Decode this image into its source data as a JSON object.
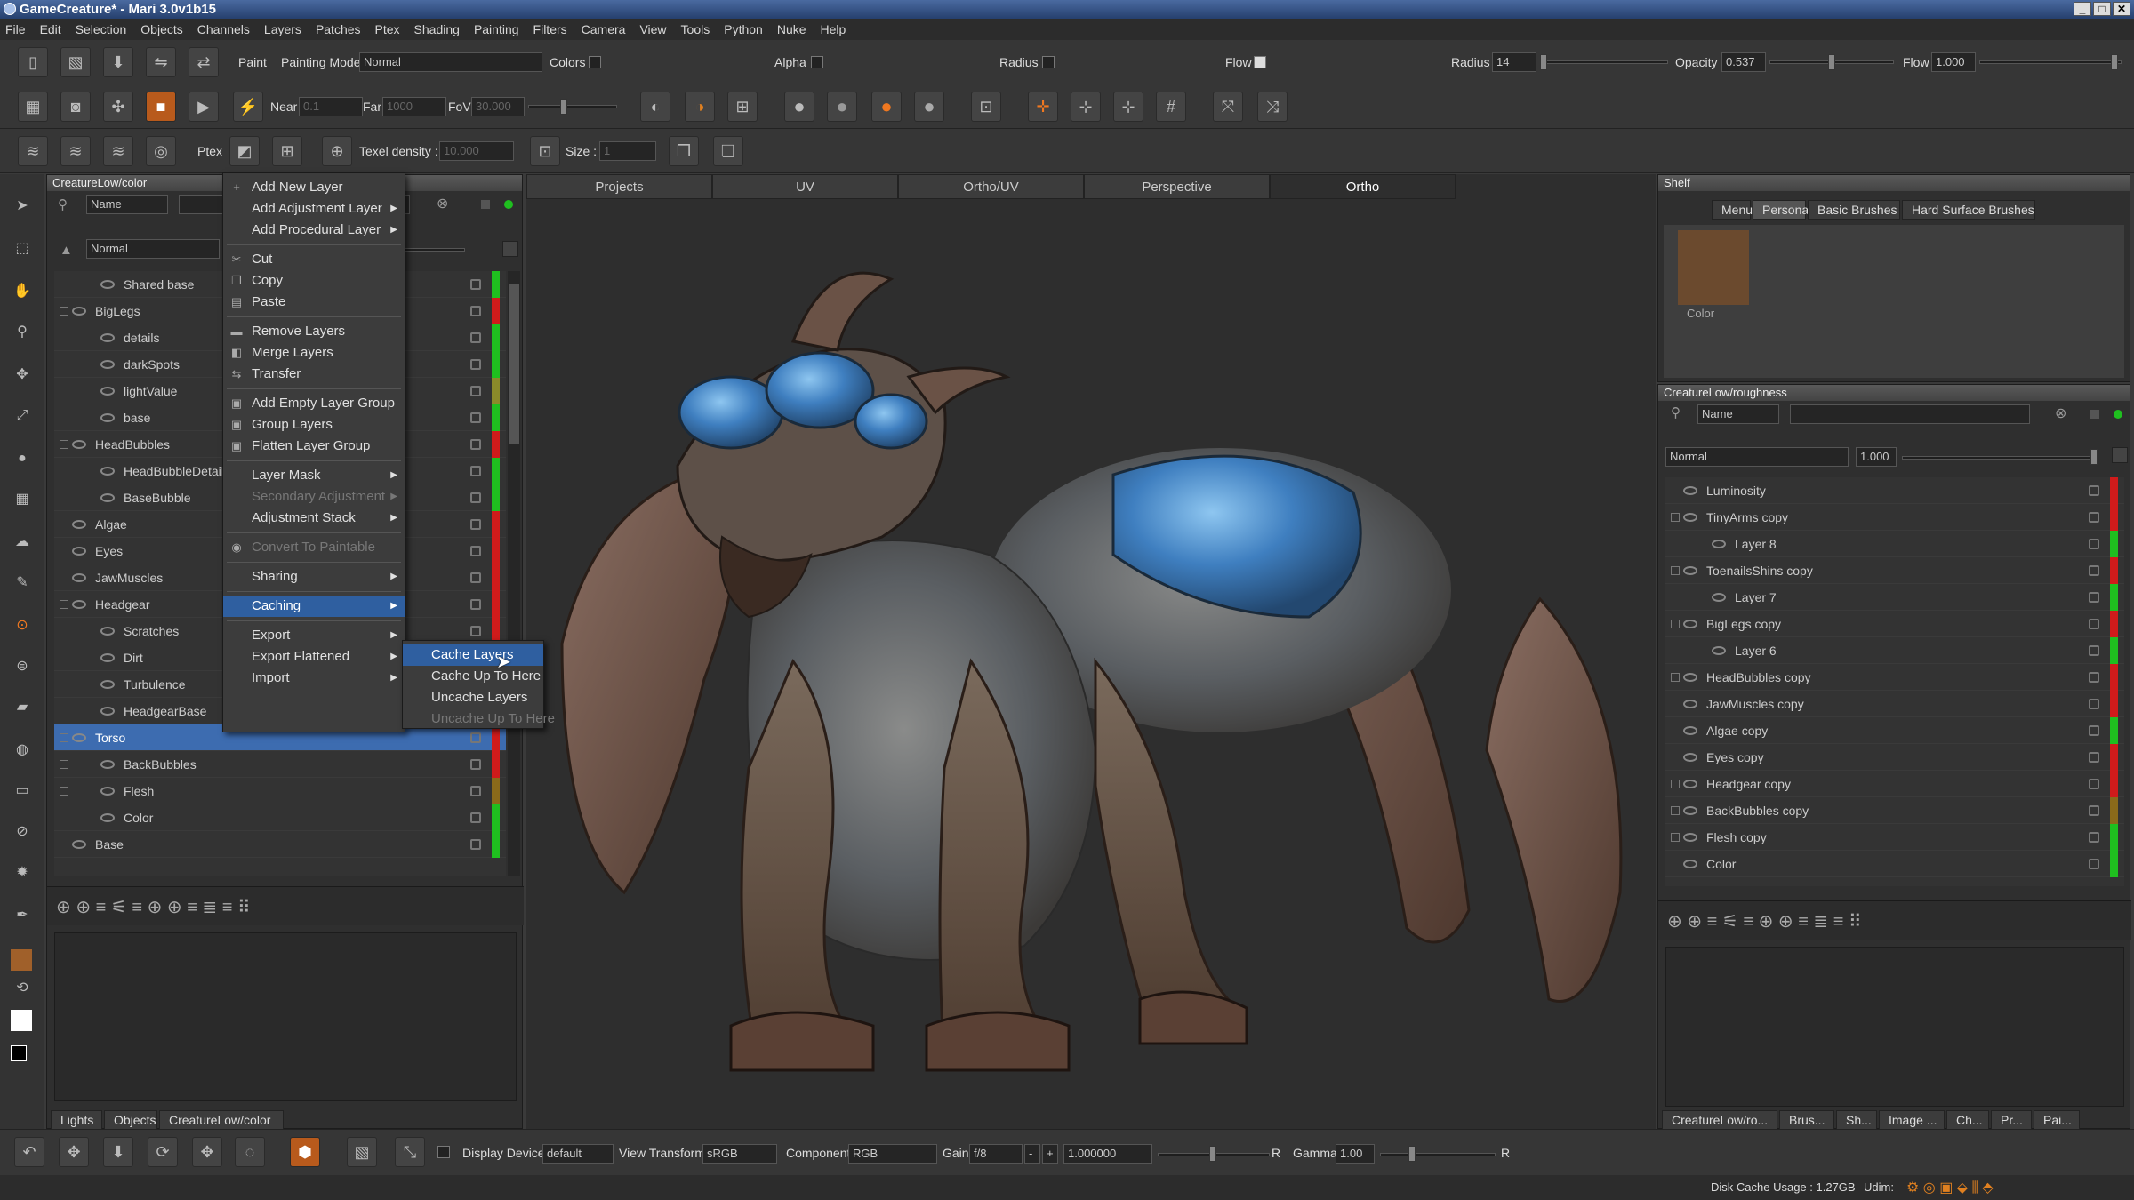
{
  "window": {
    "title": "GameCreature* - Mari 3.0v1b15"
  },
  "menubar": [
    "File",
    "Edit",
    "Selection",
    "Objects",
    "Channels",
    "Layers",
    "Patches",
    "Ptex",
    "Shading",
    "Painting",
    "Filters",
    "Camera",
    "View",
    "Tools",
    "Python",
    "Nuke",
    "Help"
  ],
  "toolbar1": {
    "paint_label": "Paint",
    "painting_mode_label": "Painting Mode",
    "painting_mode_value": "Normal",
    "colors_label": "Colors",
    "alpha_label": "Alpha",
    "radius_check_label": "Radius",
    "flow_check_label": "Flow",
    "radius_label": "Radius",
    "radius_value": "14",
    "opacity_label": "Opacity",
    "opacity_value": "0.537",
    "flow_label": "Flow",
    "flow_value": "1.000"
  },
  "toolbar2": {
    "near_label": "Near",
    "near_value": "0.1",
    "far_label": "Far",
    "far_value": "1000",
    "fov_label": "FoV",
    "fov_value": "30.000"
  },
  "toolbar3": {
    "ptex_label": "Ptex",
    "texel_label": "Texel density :",
    "texel_value": "10.000",
    "size_label": "Size :",
    "size_value": "1"
  },
  "left_panel": {
    "title": "CreatureLow/color",
    "filter_field": "Name",
    "blend_mode": "Normal",
    "layers": [
      {
        "name": "Shared base",
        "indent": 2,
        "bar": "#1fbf1f"
      },
      {
        "name": "BigLegs",
        "indent": 1,
        "group": true,
        "bar": "#d01b1b"
      },
      {
        "name": "details",
        "indent": 2,
        "bar": "#1fbf1f"
      },
      {
        "name": "darkSpots",
        "indent": 2,
        "bar": "#1fbf1f"
      },
      {
        "name": "lightValue",
        "indent": 2,
        "bar": "#8a8a2a"
      },
      {
        "name": "base",
        "indent": 2,
        "bar": "#1fbf1f"
      },
      {
        "name": "HeadBubbles",
        "indent": 1,
        "group": true,
        "bar": "#d01b1b"
      },
      {
        "name": "HeadBubbleDetail",
        "indent": 2,
        "bar": "#1fbf1f"
      },
      {
        "name": "BaseBubble",
        "indent": 2,
        "bar": "#1fbf1f"
      },
      {
        "name": "Algae",
        "indent": 1,
        "bar": "#d01b1b"
      },
      {
        "name": "Eyes",
        "indent": 1,
        "bar": "#d01b1b"
      },
      {
        "name": "JawMuscles",
        "indent": 1,
        "bar": "#d01b1b"
      },
      {
        "name": "Headgear",
        "indent": 1,
        "group": true,
        "bar": "#d01b1b"
      },
      {
        "name": "Scratches",
        "indent": 2,
        "bar": "#d01b1b"
      },
      {
        "name": "Dirt",
        "indent": 2,
        "bar": "#d01b1b"
      },
      {
        "name": "Turbulence",
        "indent": 2,
        "bar": "#d01b1b"
      },
      {
        "name": "HeadgearBase",
        "indent": 2,
        "bar": "#d01b1b"
      },
      {
        "name": "Torso",
        "indent": 1,
        "group": true,
        "selected": true,
        "bar": "#d01b1b"
      },
      {
        "name": "BackBubbles",
        "indent": 2,
        "group": true,
        "bar": "#d01b1b"
      },
      {
        "name": "Flesh",
        "indent": 2,
        "group": true,
        "bar": "#8a6a1a"
      },
      {
        "name": "Color",
        "indent": 2,
        "bar": "#1fbf1f"
      },
      {
        "name": "Base",
        "indent": 1,
        "bar": "#1fbf1f"
      }
    ],
    "tabs": [
      "Lights",
      "Objects",
      "CreatureLow/color"
    ]
  },
  "context_menu": {
    "items": [
      {
        "label": "Add New Layer",
        "icon": "+"
      },
      {
        "label": "Add Adjustment Layer",
        "sub": true
      },
      {
        "label": "Add Procedural Layer",
        "sub": true
      },
      {
        "sep": true
      },
      {
        "label": "Cut",
        "icon": "✂"
      },
      {
        "label": "Copy",
        "icon": "❐"
      },
      {
        "label": "Paste",
        "icon": "▤"
      },
      {
        "sep": true
      },
      {
        "label": "Remove Layers",
        "icon": "▬"
      },
      {
        "label": "Merge Layers",
        "icon": "◧"
      },
      {
        "label": "Transfer",
        "icon": "⇆"
      },
      {
        "sep": true
      },
      {
        "label": "Add Empty Layer Group",
        "icon": "▣"
      },
      {
        "label": "Group Layers",
        "icon": "▣"
      },
      {
        "label": "Flatten Layer Group",
        "icon": "▣"
      },
      {
        "sep": true
      },
      {
        "label": "Layer Mask",
        "sub": true
      },
      {
        "label": "Secondary Adjustment",
        "sub": true,
        "disabled": true
      },
      {
        "label": "Adjustment Stack",
        "sub": true
      },
      {
        "sep": true
      },
      {
        "label": "Convert To Paintable",
        "icon": "◉",
        "disabled": true
      },
      {
        "sep": true
      },
      {
        "label": "Sharing",
        "sub": true
      },
      {
        "sep": true
      },
      {
        "label": "Caching",
        "sub": true,
        "highlight": true
      },
      {
        "sep": true
      },
      {
        "label": "Export",
        "sub": true
      },
      {
        "label": "Export Flattened",
        "sub": true
      },
      {
        "label": "Import",
        "sub": true
      }
    ],
    "submenu": [
      {
        "label": "Cache Layers",
        "highlight": true
      },
      {
        "label": "Cache Up To Here"
      },
      {
        "label": "Uncache Layers"
      },
      {
        "label": "Uncache Up To Here",
        "disabled": true
      }
    ]
  },
  "viewport": {
    "tabs": [
      "Projects",
      "UV",
      "Ortho/UV",
      "Perspective",
      "Ortho"
    ],
    "active_tab": "Ortho"
  },
  "shelf": {
    "title": "Shelf",
    "tabs": [
      "Menu",
      "Personal",
      "Basic Brushes",
      "Hard Surface Brushes"
    ],
    "active_tab": "Personal",
    "swatch_label": "Color",
    "swatch_color": "#6b4a2e"
  },
  "right_panel": {
    "title": "CreatureLow/roughness",
    "filter_field": "Name",
    "blend_mode": "Normal",
    "opacity_value": "1.000",
    "layers": [
      {
        "name": "Luminosity",
        "indent": 1,
        "bar": "#d01b1b"
      },
      {
        "name": "TinyArms copy",
        "indent": 1,
        "group": true,
        "bar": "#d01b1b"
      },
      {
        "name": "Layer 8",
        "indent": 2,
        "bar": "#1fbf1f"
      },
      {
        "name": "ToenailsShins copy",
        "indent": 1,
        "group": true,
        "bar": "#d01b1b"
      },
      {
        "name": "Layer 7",
        "indent": 2,
        "bar": "#1fbf1f"
      },
      {
        "name": "BigLegs copy",
        "indent": 1,
        "group": true,
        "bar": "#d01b1b"
      },
      {
        "name": "Layer 6",
        "indent": 2,
        "bar": "#1fbf1f"
      },
      {
        "name": "HeadBubbles copy",
        "indent": 1,
        "group": true,
        "bar": "#d01b1b"
      },
      {
        "name": "JawMuscles copy",
        "indent": 1,
        "bar": "#d01b1b"
      },
      {
        "name": "Algae copy",
        "indent": 1,
        "bar": "#1fbf1f"
      },
      {
        "name": "Eyes copy",
        "indent": 1,
        "bar": "#d01b1b"
      },
      {
        "name": "Headgear copy",
        "indent": 1,
        "group": true,
        "bar": "#d01b1b"
      },
      {
        "name": "BackBubbles copy",
        "indent": 1,
        "group": true,
        "bar": "#8a6a1a"
      },
      {
        "name": "Flesh copy",
        "indent": 1,
        "group": true,
        "bar": "#1fbf1f"
      },
      {
        "name": "Color",
        "indent": 1,
        "bar": "#1fbf1f"
      }
    ],
    "tabs": [
      "CreatureLow/ro...",
      "Brus...",
      "Sh...",
      "Image ...",
      "Ch...",
      "Pr...",
      "Pai..."
    ]
  },
  "statusbar": {
    "display_device_label": "Display Device",
    "display_device_value": "default",
    "view_transform_label": "View Transform",
    "view_transform_value": "sRGB",
    "component_label": "Component",
    "component_value": "RGB",
    "gain_label": "Gain",
    "gain_value": "f/8",
    "minus": "-",
    "plus": "+",
    "exposure_value": "1.000000",
    "r1": "R",
    "gamma_label": "Gamma",
    "gamma_value": "1.00",
    "r2": "R"
  },
  "bottom": {
    "disk_cache": "Disk Cache Usage : 1.27GB",
    "udim": "Udim:"
  }
}
